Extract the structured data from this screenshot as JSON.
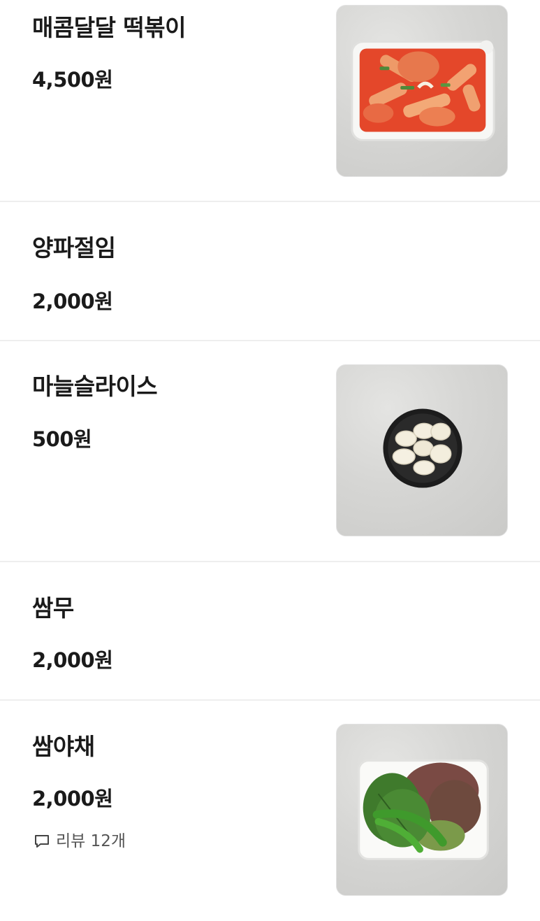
{
  "menu": {
    "items": [
      {
        "name": "매콤달달 떡볶이",
        "price": "4,500원",
        "image": "tteokbokki-container"
      },
      {
        "name": "양파절임",
        "price": "2,000원"
      },
      {
        "name": "마늘슬라이스",
        "price": "500원",
        "image": "sliced-garlic-cup"
      },
      {
        "name": "쌈무",
        "price": "2,000원"
      },
      {
        "name": "쌈야채",
        "price": "2,000원",
        "review": {
          "icon": "speech-bubble-icon",
          "label": "리뷰 12개"
        },
        "image": "lettuce-wrap-vegetables"
      }
    ]
  }
}
